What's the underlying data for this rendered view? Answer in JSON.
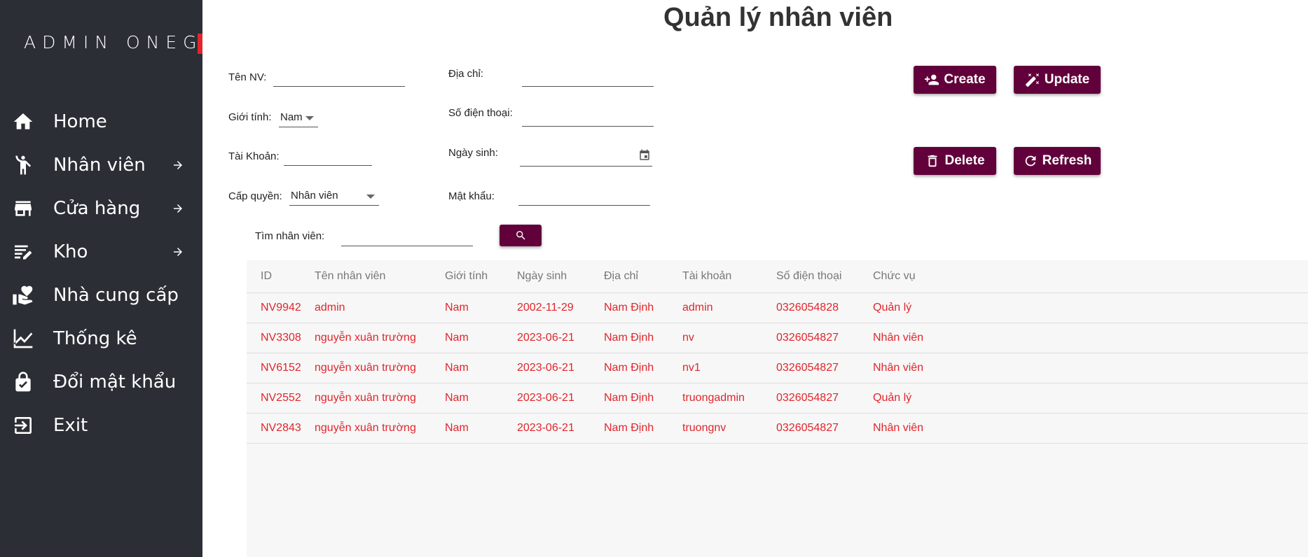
{
  "sidebar": {
    "brand": "ADMIN ONEG",
    "items": [
      {
        "label": "Home",
        "icon": "home-icon"
      },
      {
        "label": "Nhân viên",
        "icon": "person-icon",
        "arrow": true
      },
      {
        "label": "Cửa hàng",
        "icon": "store-icon",
        "arrow": true
      },
      {
        "label": "Kho",
        "icon": "warehouse-edit-icon",
        "arrow": true
      },
      {
        "label": "Nhà cung cấp",
        "icon": "supplier-hand-icon"
      },
      {
        "label": "Thống kê",
        "icon": "chart-icon"
      },
      {
        "label": "Đổi mật khẩu",
        "icon": "lock-icon"
      },
      {
        "label": "Exit",
        "icon": "exit-icon"
      }
    ]
  },
  "page": {
    "title": "Quản lý nhân viên"
  },
  "form": {
    "ten_nv": {
      "label": "Tên NV:",
      "value": ""
    },
    "gioi_tinh": {
      "label": "Giới tính:",
      "value": "Nam"
    },
    "tai_khoan": {
      "label": "Tài Khoản:",
      "value": ""
    },
    "cap_quyen": {
      "label": "Cấp quyền:",
      "value": "Nhân viên"
    },
    "dia_chi": {
      "label": "Địa chỉ:",
      "value": ""
    },
    "so_dien_thoai": {
      "label": "Số điện thoại:",
      "value": ""
    },
    "ngay_sinh": {
      "label": "Ngày sinh:",
      "value": ""
    },
    "mat_khau": {
      "label": "Mật khẩu:",
      "value": ""
    },
    "search": {
      "label": "Tìm nhân viên:",
      "value": ""
    }
  },
  "actions": {
    "create": "Create",
    "update": "Update",
    "delete": "Delete",
    "refresh": "Refresh"
  },
  "table": {
    "headers": [
      "ID",
      "Tên nhân viên",
      "Giới tính",
      "Ngày sinh",
      "Địa chỉ",
      "Tài khoản",
      "Số điện thoại",
      "Chức vụ"
    ],
    "rows": [
      [
        "NV9942",
        "admin",
        "Nam",
        "2002-11-29",
        "Nam Định",
        "admin",
        "0326054828",
        "Quản lý"
      ],
      [
        "NV3308",
        "nguyễn xuân trường",
        "Nam",
        "2023-06-21",
        "Nam Định",
        "nv",
        "0326054827",
        "Nhân viên"
      ],
      [
        "NV6152",
        "nguyễn xuân trường",
        "Nam",
        "2023-06-21",
        "Nam Định",
        "nv1",
        "0326054827",
        "Nhân viên"
      ],
      [
        "NV2552",
        "nguyễn xuân trường",
        "Nam",
        "2023-06-21",
        "Nam Định",
        "truongadmin",
        "0326054827",
        "Quản lý"
      ],
      [
        "NV2843",
        "nguyễn xuân trường",
        "Nam",
        "2023-06-21",
        "Nam Định",
        "truongnv",
        "0326054827",
        "Nhân viên"
      ]
    ]
  },
  "colors": {
    "sidebar_bg": "#2b2e35",
    "accent": "#e0262c",
    "button_bg": "#61003a",
    "row_text": "#e0262c"
  }
}
